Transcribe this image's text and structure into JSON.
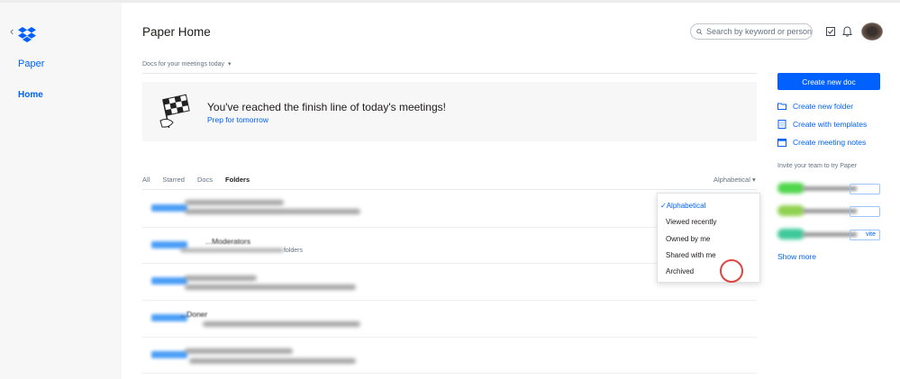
{
  "sidebar": {
    "back_glyph": "‹",
    "logo_icon": "dropbox-logo-icon",
    "items": [
      {
        "label": "Paper"
      },
      {
        "label": "Home"
      }
    ]
  },
  "header": {
    "title": "Paper Home",
    "search_placeholder": "Search by keyword or person",
    "icons": [
      "checkbox-icon",
      "bell-icon",
      "avatar"
    ]
  },
  "meetings": {
    "filter_label": "Docs for your meetings today",
    "caret": "▾",
    "banner_title": "You've reached the finish line of today's meetings!",
    "banner_link": "Prep for tomorrow"
  },
  "tabs": [
    {
      "label": "All",
      "active": false
    },
    {
      "label": "Starred",
      "active": false
    },
    {
      "label": "Docs",
      "active": false
    },
    {
      "label": "Folders",
      "active": true
    }
  ],
  "sort": {
    "label": "Alphabetical",
    "caret": "▾",
    "options": [
      {
        "label": "Alphabetical",
        "selected": true,
        "check": "✓"
      },
      {
        "label": "Viewed recently",
        "selected": false
      },
      {
        "label": "Owned by me",
        "selected": false
      },
      {
        "label": "Shared with me",
        "selected": false
      },
      {
        "label": "Archived",
        "selected": false
      }
    ]
  },
  "rows": [
    {
      "title": "",
      "subtitle": ""
    },
    {
      "title": "...Moderators",
      "subtitle": "folders"
    },
    {
      "title": "",
      "subtitle": ""
    },
    {
      "title": "...Doner",
      "subtitle": ""
    },
    {
      "title": "",
      "subtitle": ""
    }
  ],
  "actions": {
    "create_button": "Create new doc",
    "items": [
      {
        "label": "Create new folder",
        "icon": "folder-icon"
      },
      {
        "label": "Create with templates",
        "icon": "template-icon"
      },
      {
        "label": "Create meeting notes",
        "icon": "calendar-icon"
      }
    ],
    "invite_label": "Invite your team to try Paper",
    "invite_rows": [
      {
        "button": "",
        "color": "#4fd64a"
      },
      {
        "button": "",
        "color": "#8fd14f"
      },
      {
        "button": "vite",
        "color": "#3ec99a"
      }
    ],
    "show_more": "Show more"
  },
  "colors": {
    "accent": "#0061fe",
    "sidebar_bg": "#f7f7f7",
    "cursor_ring": "#e0443e"
  }
}
